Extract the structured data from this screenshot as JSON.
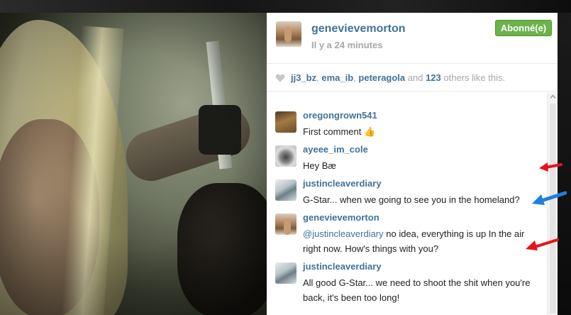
{
  "post": {
    "username": "genevievemorton",
    "timestamp": "Il y a 24 minutes",
    "follow_label": "Abonné(e)"
  },
  "likes": {
    "users": [
      "jj3_bz",
      "ema_ib",
      "peteragola"
    ],
    "separator": ", ",
    "and_text": " and ",
    "count": "123",
    "suffix": " others like this."
  },
  "comments": [
    {
      "username": "oregongrown541",
      "text": "First comment 👍"
    },
    {
      "username": "ayeee_im_cole",
      "text": "Hey Bæ"
    },
    {
      "username": "justincleaverdiary",
      "text": "G-Star... when we going to see you in the homeland?"
    },
    {
      "username": "genevievemorton",
      "mention": "@justincleaverdiary",
      "text": " no idea, everything is up In the air right now. How's things with you?"
    },
    {
      "username": "justincleaverdiary",
      "text": "All good G-Star... we need to shoot the shit when you're back, it's been too long!"
    }
  ],
  "colors": {
    "link": "#3f729b",
    "follow_button": "#6bb34a",
    "arrow_red": "#e8121b",
    "arrow_blue": "#1e7fe0"
  },
  "icons": [
    "heart-icon",
    "scroll-up-icon",
    "red-arrow-icon",
    "blue-arrow-icon"
  ]
}
